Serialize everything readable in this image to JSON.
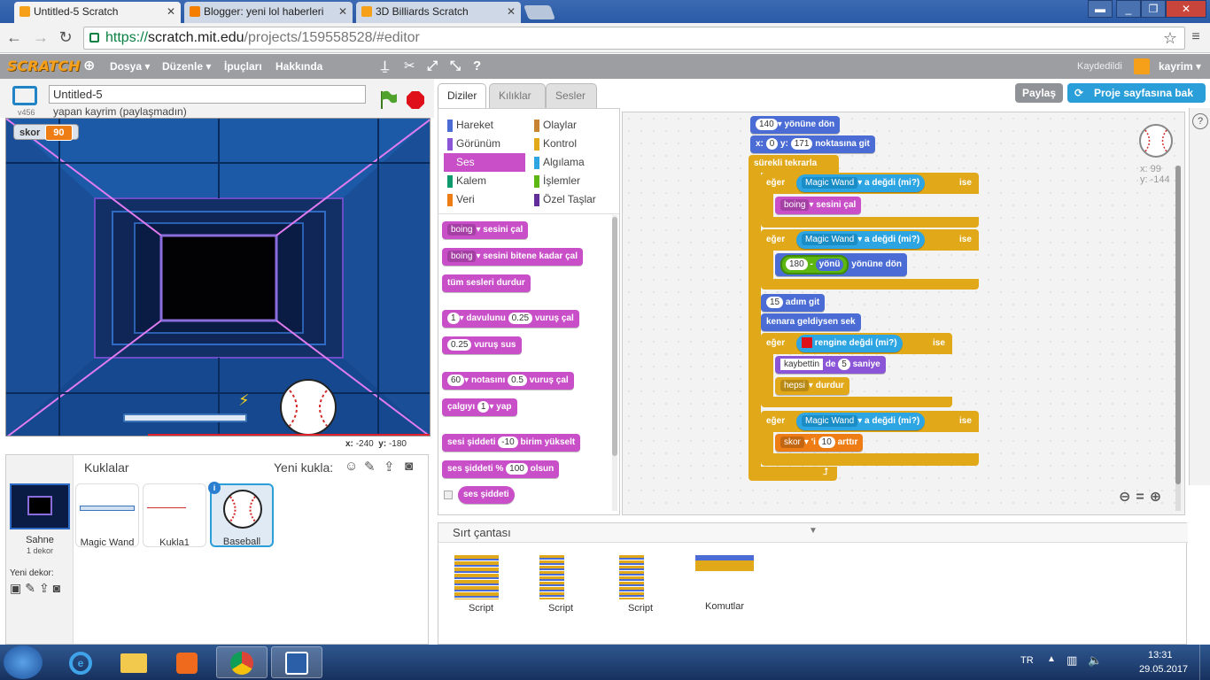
{
  "browser": {
    "tabs": [
      {
        "label": "Untitled-5 Scratch",
        "active": true
      },
      {
        "label": "Blogger: yeni lol haberleri",
        "active": false
      },
      {
        "label": "3D Billiards Scratch",
        "active": false
      }
    ],
    "url": {
      "scheme": "https://",
      "host": "scratch.mit.edu",
      "path": "/projects/159558528/#editor"
    }
  },
  "menu": {
    "logo": "SCRATCH",
    "items": [
      "Dosya ▾",
      "Düzenle ▾",
      "İpuçları",
      "Hakkında"
    ],
    "status": "Kaydedildi",
    "user": "kayrim ▾"
  },
  "project": {
    "title": "Untitled-5",
    "byline": "yapan kayrim (paylaşmadın)",
    "version": "v456",
    "share": "Paylaş",
    "see_page": "Proje sayfasına bak"
  },
  "stage": {
    "monitor_label": "skor",
    "monitor_value": "90",
    "coords": {
      "x_label": "x:",
      "x": "-240",
      "y_label": "y:",
      "y": "-180"
    }
  },
  "sprites": {
    "header": "Kuklalar",
    "new_sprite": "Yeni kukla:",
    "stage_label": "Sahne",
    "stage_sub": "1 dekor",
    "new_backdrop": "Yeni dekor:",
    "items": [
      "Magic Wand",
      "Kukla1",
      "Baseball"
    ]
  },
  "palette": {
    "tabs": [
      "Diziler",
      "Kılıklar",
      "Sesler"
    ],
    "categories": [
      {
        "label": "Hareket",
        "color": "#4a6cd4"
      },
      {
        "label": "Olaylar",
        "color": "#c88330"
      },
      {
        "label": "Görünüm",
        "color": "#8a55d7"
      },
      {
        "label": "Kontrol",
        "color": "#e1a91a"
      },
      {
        "label": "Ses",
        "color": "#c94fc9"
      },
      {
        "label": "Algılama",
        "color": "#2ca5e2"
      },
      {
        "label": "Kalem",
        "color": "#0e9a6c"
      },
      {
        "label": "İşlemler",
        "color": "#5cb712"
      },
      {
        "label": "Veri",
        "color": "#ee7d16"
      },
      {
        "label": "Özel Taşlar",
        "color": "#632d99"
      }
    ],
    "blocks": {
      "b1_drop": "boing",
      "b1_text": "sesini çal",
      "b2_drop": "boing",
      "b2_text": "sesini bitene kadar çal",
      "b3_text": "tüm sesleri durdur",
      "b4_drop": "1",
      "b4_a": "davulunu",
      "b4_val": "0.25",
      "b4_b": "vuruş çal",
      "b5_val": "0.25",
      "b5_text": "vuruş sus",
      "b6_drop": "60",
      "b6_a": "notasını",
      "b6_val": "0.5",
      "b6_b": "vuruş çal",
      "b7_a": "çalgıyı",
      "b7_drop": "1",
      "b7_b": "yap",
      "b8_a": "sesi şiddeti",
      "b8_val": "-10",
      "b8_b": "birim yükselt",
      "b9_a": "ses şiddeti %",
      "b9_val": "100",
      "b9_b": "olsun",
      "b10_text": "ses şiddeti"
    }
  },
  "script": {
    "s1_drop": "140",
    "s1_text": "yönüne dön",
    "s2_x": "x:",
    "s2_xv": "0",
    "s2_y": "y:",
    "s2_yv": "171",
    "s2_text": "noktasına git",
    "s3": "sürekli tekrarla",
    "if": "eğer",
    "then": "ise",
    "wand": "Magic Wand",
    "touching": "a değdi (mi?)",
    "s_boing": "boing",
    "s_play": "sesini çal",
    "op_num": "180",
    "op_minus": "-",
    "op_dir": "yönü",
    "op_turn": "yönüne dön",
    "move_val": "15",
    "move_text": "adım git",
    "bounce": "kenara geldiysen sek",
    "color_touch": "rengine değdi (mi?)",
    "say_text": "kaybettin",
    "say_de": "de",
    "say_val": "5",
    "say_sec": "saniye",
    "stop_drop": "hepsi",
    "stop_text": "durdur",
    "var_drop": "skor",
    "var_i": "'i",
    "var_val": "10",
    "var_inc": "arttır",
    "sprite_x": "x: 99",
    "sprite_y": "y: -144"
  },
  "backpack": {
    "title": "Sırt çantası",
    "items": [
      "Script",
      "Script",
      "Script",
      "Komutlar"
    ]
  },
  "taskbar": {
    "lang": "TR",
    "time": "13:31",
    "date": "29.05.2017"
  }
}
